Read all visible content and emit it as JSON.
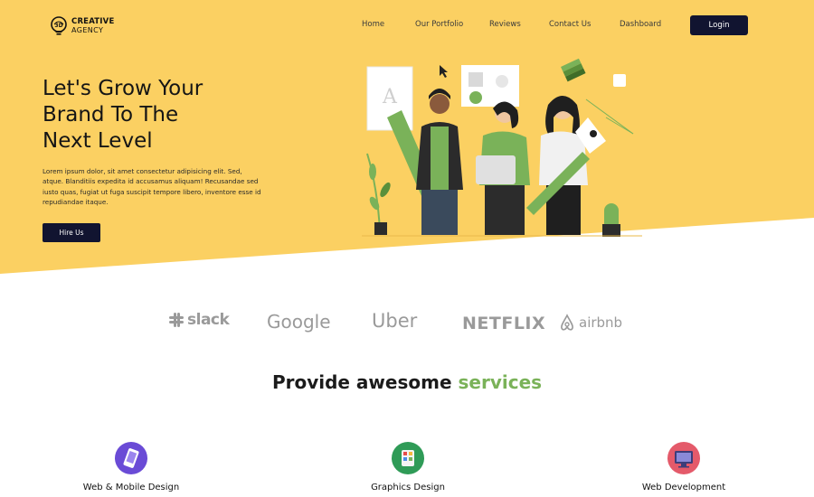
{
  "logo": {
    "line1": "CREATIVE",
    "line2": "AGENCY"
  },
  "nav": {
    "items": [
      "Home",
      "Our Portfolio",
      "Reviews",
      "Contact Us",
      "Dashboard"
    ],
    "login_label": "Login"
  },
  "hero": {
    "title_lines": [
      "Let's Grow Your",
      "Brand To The",
      "Next Level"
    ],
    "description": "Lorem ipsum dolor, sit amet consectetur adipisicing elit. Sed, atque. Blanditiis expedita id accusamus aliquam! Recusandae sed iusto quas, fugiat ut fuga suscipit tempore libero, inventore esse id repudiandae itaque.",
    "cta_label": "Hire Us"
  },
  "brands": [
    "slack",
    "Google",
    "Uber",
    "NETFLIX",
    "airbnb"
  ],
  "services": {
    "title_main": "Provide awesome",
    "title_accent": "services",
    "items": [
      {
        "label": "Web & Mobile Design",
        "icon": "mobile-design-icon"
      },
      {
        "label": "Graphics Design",
        "icon": "graphics-design-icon"
      },
      {
        "label": "Web Development",
        "icon": "web-development-icon"
      }
    ]
  },
  "colors": {
    "hero_bg": "#fbd062",
    "dark_button": "#111430",
    "accent_green": "#7ab259",
    "brand_gray": "#9a9a9a"
  }
}
